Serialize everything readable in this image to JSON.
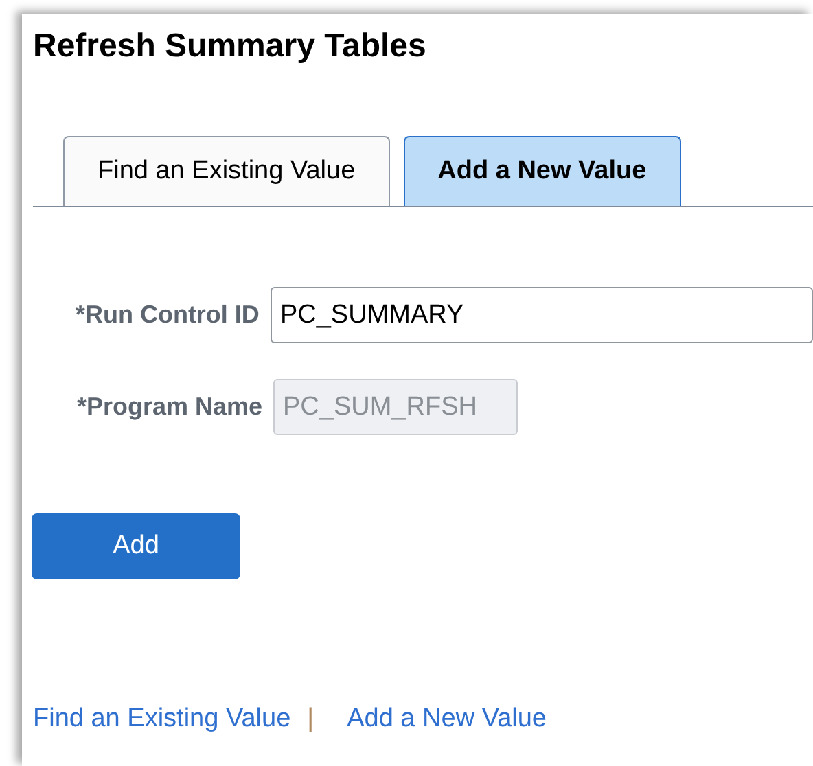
{
  "title": "Refresh Summary Tables",
  "tabs": [
    {
      "label": "Find an Existing Value",
      "selected": false
    },
    {
      "label": "Add a New Value",
      "selected": true
    }
  ],
  "fields": [
    {
      "label": "*Run Control ID",
      "value": "PC_SUMMARY",
      "disabled": false
    },
    {
      "label": "*Program Name",
      "value": "PC_SUM_RFSH",
      "disabled": true
    }
  ],
  "button": "Add",
  "footer_links": [
    "Find an Existing Value",
    "Add a New Value"
  ],
  "separator": "|"
}
